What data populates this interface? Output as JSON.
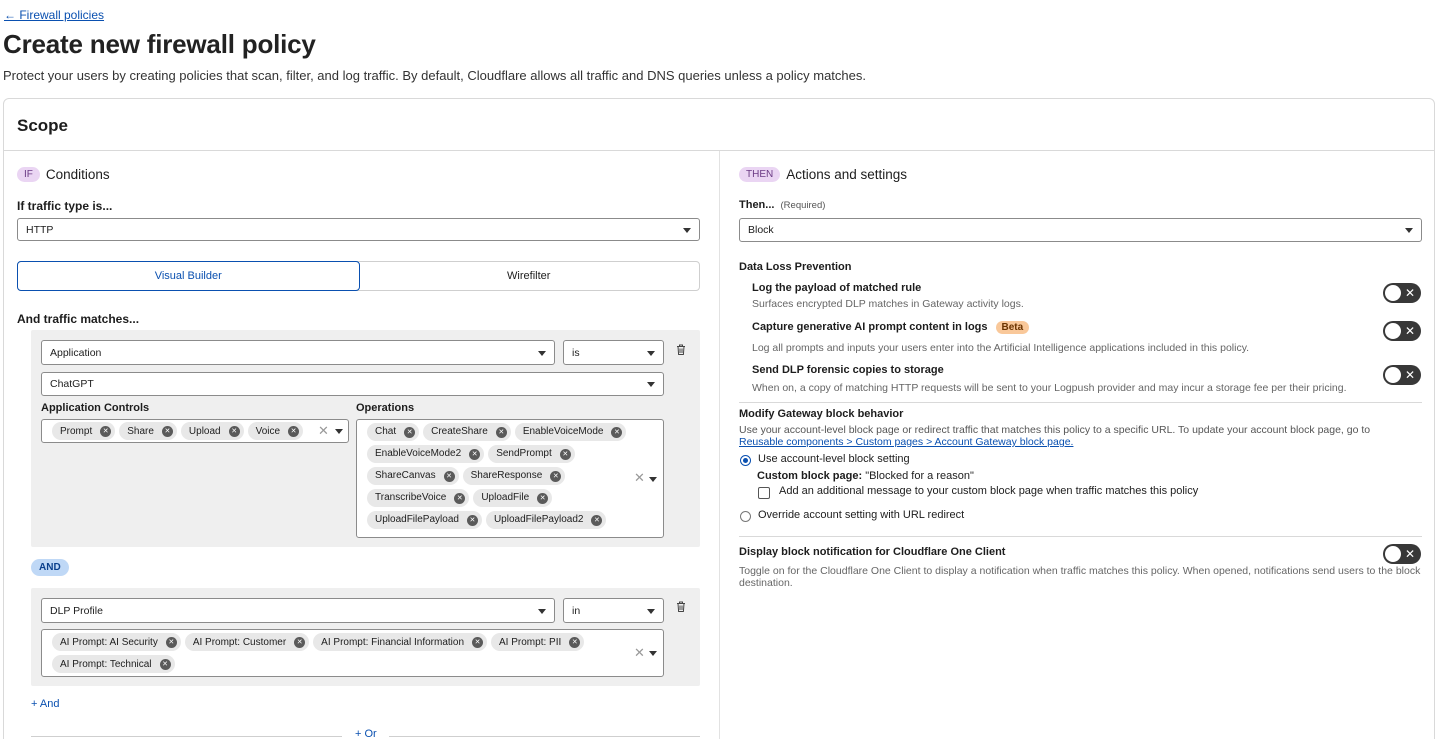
{
  "header": {
    "back_link": "← Firewall policies",
    "title": "Create new firewall policy",
    "description": "Protect your users by creating policies that scan, filter, and log traffic. By default, Cloudflare allows all traffic and DNS queries unless a policy matches."
  },
  "scope": {
    "title": "Scope"
  },
  "conditions": {
    "badge": "IF",
    "title": "Conditions",
    "traffic_type_label": "If traffic type is...",
    "traffic_type_value": "HTTP",
    "builder_tabs": [
      "Visual Builder",
      "Wirefilter"
    ],
    "matches_label": "And traffic matches...",
    "group1": {
      "selector": "Application",
      "operator": "is",
      "value": "ChatGPT",
      "app_controls_label": "Application Controls",
      "app_controls": [
        "Prompt",
        "Share",
        "Upload",
        "Voice"
      ],
      "operations_label": "Operations",
      "operations": [
        "Chat",
        "CreateShare",
        "EnableVoiceMode",
        "EnableVoiceMode2",
        "SendPrompt",
        "ShareCanvas",
        "ShareResponse",
        "TranscribeVoice",
        "UploadFile",
        "UploadFilePayload",
        "UploadFilePayload2"
      ]
    },
    "and_badge": "AND",
    "group2": {
      "selector": "DLP Profile",
      "operator": "in",
      "values": [
        "AI Prompt: AI Security",
        "AI Prompt: Customer",
        "AI Prompt: Financial Information",
        "AI Prompt: PII",
        "AI Prompt: Technical"
      ]
    },
    "add_and": "+ And",
    "add_or": "+ Or"
  },
  "actions": {
    "badge": "THEN",
    "title": "Actions and settings",
    "then_label": "Then...",
    "then_required": "(Required)",
    "then_value": "Block",
    "dlp_heading": "Data Loss Prevention",
    "dlp_items": [
      {
        "title": "Log the payload of matched rule",
        "desc": "Surfaces encrypted DLP matches in Gateway activity logs.",
        "enabled": false
      },
      {
        "title": "Capture generative AI prompt content in logs",
        "badge": "Beta",
        "desc": "Log all prompts and inputs your users enter into the Artificial Intelligence applications included in this policy.",
        "enabled": false
      },
      {
        "title": "Send DLP forensic copies to storage",
        "desc": "When on, a copy of matching HTTP requests will be sent to your Logpush provider and may incur a storage fee per their pricing.",
        "enabled": false
      }
    ],
    "modify_heading": "Modify Gateway block behavior",
    "modify_desc": "Use your account-level block page or redirect traffic that matches this policy to a specific URL. To update your account block page, go to",
    "modify_link": "Reusable components > Custom pages > Account Gateway block page.",
    "radio_account": "Use account-level block setting",
    "custom_block_label": "Custom block page:",
    "custom_block_value": "\"Blocked for a reason\"",
    "add_message_label": "Add an additional message to your custom block page when traffic matches this policy",
    "radio_override": "Override account setting with URL redirect",
    "notify_title": "Display block notification for Cloudflare One Client",
    "notify_desc": "Toggle on for the Cloudflare One Client to display a notification when traffic matches this policy. When opened, notifications send users to the block destination."
  },
  "colors": {
    "link": "#0a50b0",
    "toggle_off": "#383838",
    "if_badge": "#ead5f3",
    "and_badge": "#bfd8f6",
    "beta": "#f9c89a"
  }
}
